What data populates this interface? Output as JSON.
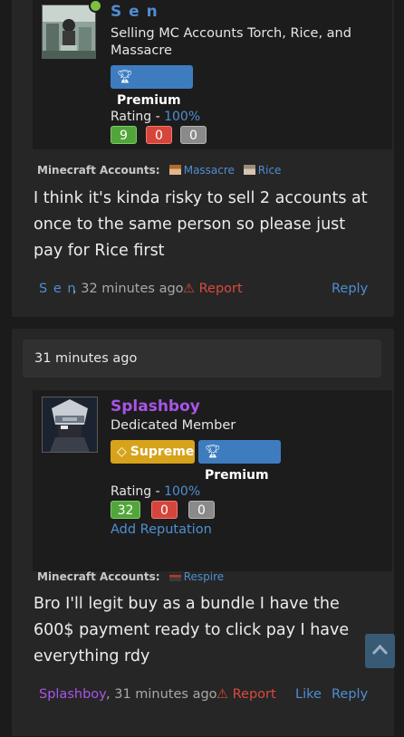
{
  "posts": [
    {
      "username": "S e n",
      "subtitle": "Selling MC Accounts Torch, Rice, and Massacre",
      "online": true,
      "badges": [
        "Premium"
      ],
      "rating": {
        "label": "Rating - ",
        "percent": "100%",
        "positive": "9",
        "negative": "0",
        "neutral": "0"
      },
      "mc_accounts_label": "Minecraft Accounts:",
      "mc_accounts": [
        "Massacre",
        "Rice"
      ],
      "message": "I think it's kinda risky to sell 2 accounts at once to the same person so please just pay for Rice first",
      "footer": {
        "author": "S e n",
        "time": ", 32 minutes ago",
        "report": "Report",
        "reply": "Reply"
      }
    },
    {
      "date_bar": "31 minutes ago",
      "username": "Splashboy",
      "subtitle": "Dedicated Member",
      "badges": [
        "Supreme",
        "Premium"
      ],
      "rating": {
        "label": "Rating - ",
        "percent": "100%",
        "positive": "32",
        "negative": "0",
        "neutral": "0"
      },
      "add_reputation": "Add Reputation",
      "mc_accounts_label": "Minecraft Accounts:",
      "mc_accounts": [
        "Respire"
      ],
      "message": "Bro I'll legit buy as a bundle I have the 600$ payment ready to click pay I have everything rdy",
      "footer": {
        "author": "Splashboy",
        "time": ", 31 minutes ago",
        "report": "Report",
        "like": "Like",
        "reply": "Reply"
      }
    }
  ],
  "colors": {
    "link": "#4f8ed1",
    "username_1": "#4f8ed1",
    "username_2": "#a855e8",
    "author_2": "#a855e8",
    "premium": "#3e7cc0",
    "supreme": "#d6a31b",
    "report": "#d94a3e"
  }
}
